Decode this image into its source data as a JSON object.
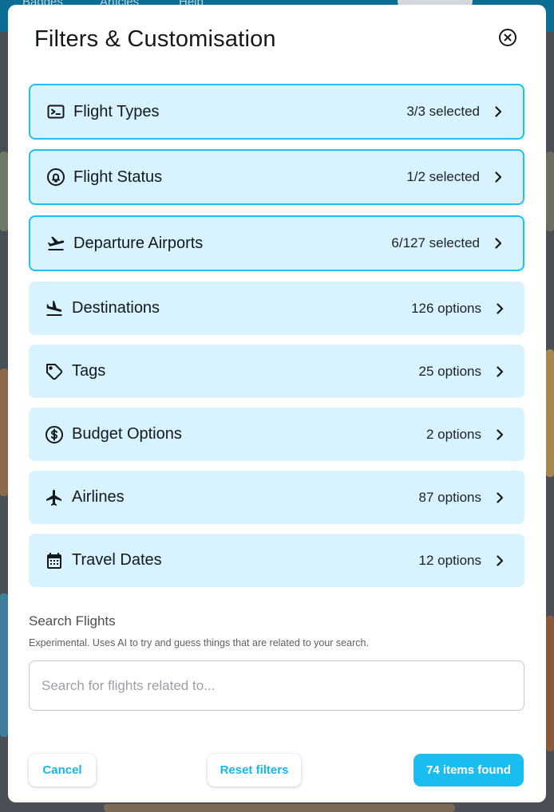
{
  "background_page": {
    "nav": [
      "Badges",
      "Articles",
      "Help"
    ]
  },
  "modal": {
    "title": "Filters & Customisation",
    "close_icon": "close-circle-icon"
  },
  "filters": [
    {
      "label": "Flight Types",
      "count": "3/3 selected",
      "icon": "terminal-icon",
      "active": true
    },
    {
      "label": "Flight Status",
      "count": "1/2 selected",
      "icon": "bell-circle-icon",
      "active": true
    },
    {
      "label": "Departure Airports",
      "count": "6/127 selected",
      "icon": "flight-takeoff-icon",
      "active": true
    },
    {
      "label": "Destinations",
      "count": "126 options",
      "icon": "flight-land-icon",
      "active": false
    },
    {
      "label": "Tags",
      "count": "25 options",
      "icon": "tag-icon",
      "active": false
    },
    {
      "label": "Budget Options",
      "count": "2 options",
      "icon": "dollar-circle-icon",
      "active": false
    },
    {
      "label": "Airlines",
      "count": "87 options",
      "icon": "airplane-icon",
      "active": false
    },
    {
      "label": "Travel Dates",
      "count": "12 options",
      "icon": "calendar-icon",
      "active": false
    }
  ],
  "search": {
    "label": "Search Flights",
    "help": "Experimental. Uses AI to try and guess things that are related to your search.",
    "placeholder": "Search for flights related to...",
    "value": ""
  },
  "footer": {
    "cancel_label": "Cancel",
    "reset_label": "Reset filters",
    "found_label": "74 items found"
  },
  "colors": {
    "accent": "#19bdf0",
    "row_background": "#d8f3fd",
    "active_border": "#1ec0f2",
    "text": "#14191e"
  }
}
